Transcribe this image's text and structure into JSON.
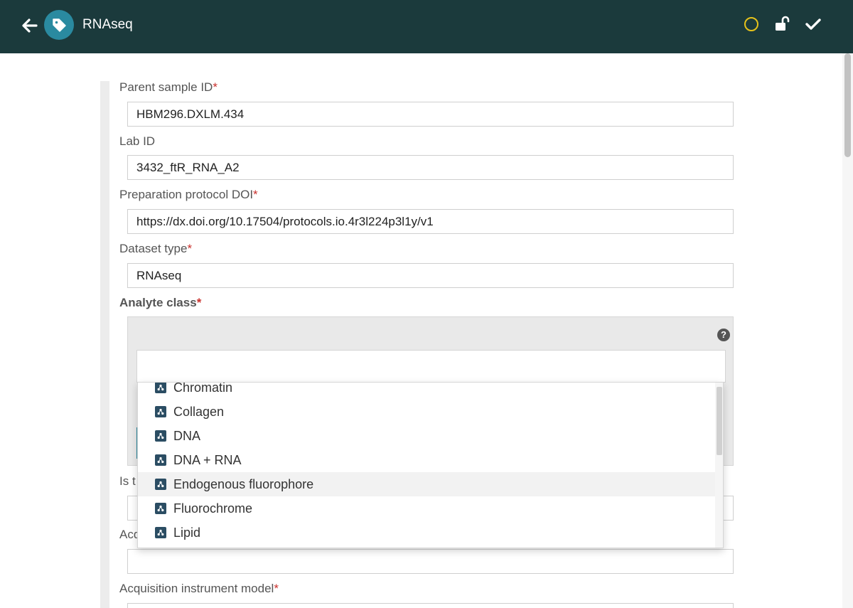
{
  "header": {
    "title": "RNAseq",
    "back_icon": "arrow-left-icon",
    "tag_icon": "tag-icon",
    "status_icon": "circle-outline-icon",
    "lock_icon": "unlock-icon",
    "save_icon": "check-icon",
    "bar_color": "#1b3a3c",
    "accent_color": "#2a8aa0",
    "status_color": "#e6c21a"
  },
  "form": {
    "parent_sample_id": {
      "label": "Parent sample ID",
      "required_mark": "*",
      "value": "HBM296.DXLM.434"
    },
    "lab_id": {
      "label": "Lab ID",
      "value": "3432_ftR_RNA_A2"
    },
    "preparation_protocol_doi": {
      "label": "Preparation protocol DOI",
      "required_mark": "*",
      "value": "https://dx.doi.org/10.17504/protocols.io.4r3l224p3l1y/v1"
    },
    "dataset_type": {
      "label": "Dataset type",
      "required_mark": "*",
      "value": "RNAseq"
    },
    "analyte_class": {
      "label": "Analyte class",
      "required_mark": "*",
      "help_icon": "question-circle-icon",
      "search_value": "",
      "options": [
        "Chromatin",
        "Collagen",
        "DNA",
        "DNA + RNA",
        "Endogenous fluorophore",
        "Fluorochrome",
        "Lipid"
      ],
      "highlighted_option": "Endogenous fluorophore",
      "option_icon": "molecule-icon"
    },
    "partial_label_1": "Is t",
    "partial_label_2": "Acq",
    "acquisition_instrument_model": {
      "label": "Acquisition instrument model",
      "required_mark": "*"
    }
  }
}
